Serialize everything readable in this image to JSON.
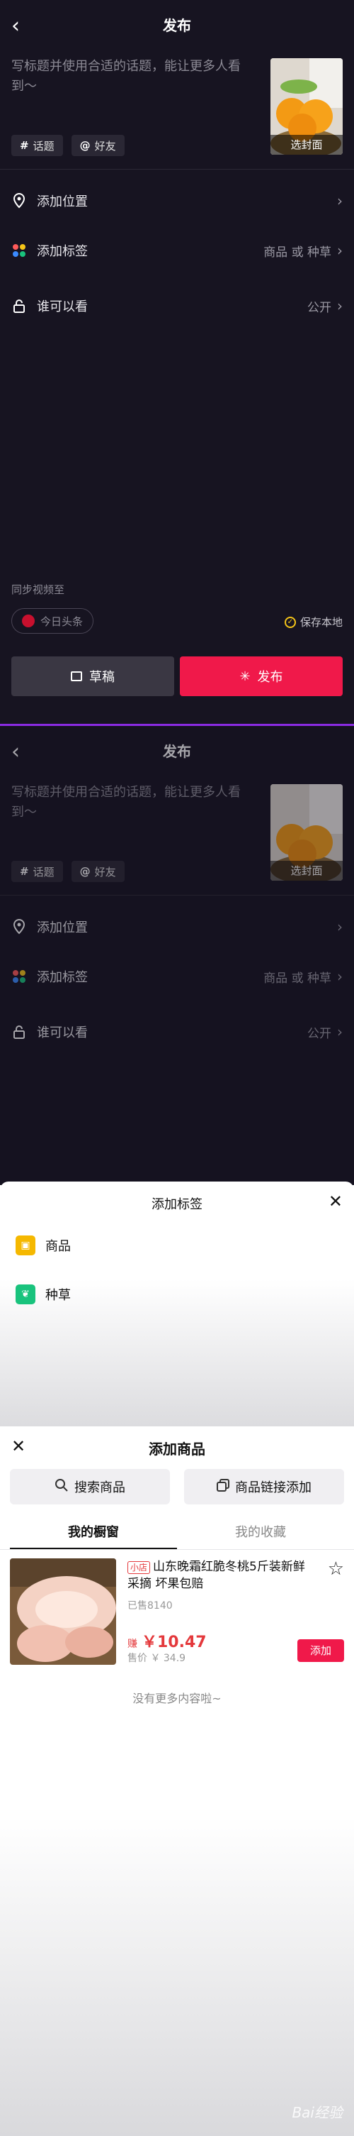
{
  "publish": {
    "title": "发布",
    "caption_placeholder": "写标题并使用合适的话题，能让更多人看到～",
    "cover_label": "选封面",
    "chips": [
      {
        "icon": "hash-icon",
        "label": "话题"
      },
      {
        "icon": "at-icon",
        "label": "好友"
      }
    ],
    "rows": {
      "location": {
        "label": "添加位置"
      },
      "tag": {
        "label": "添加标签",
        "value": "商品 或 种草"
      },
      "visibility": {
        "label": "谁可以看",
        "value": "公开"
      }
    },
    "sync_label": "同步视频至",
    "toutiao_label": "今日头条",
    "save_local_label": "保存本地",
    "draft_label": "草稿",
    "publish_label": "发布"
  },
  "tag_sheet": {
    "title": "添加标签",
    "items": [
      {
        "label": "商品",
        "color": "#f5b800"
      },
      {
        "label": "种草",
        "color": "#19c37d"
      }
    ]
  },
  "add_product": {
    "title": "添加商品",
    "search_label": "搜索商品",
    "link_label": "商品链接添加",
    "tabs": [
      "我的橱窗",
      "我的收藏"
    ],
    "product": {
      "badge": "小店",
      "name": "山东晚霜红脆冬桃5斤装新鲜采摘 坏果包赔",
      "sold": "已售8140",
      "earn_prefix": "赚",
      "earn_value": "￥10.47",
      "price": "售价 ￥ 34.9",
      "add_label": "添加"
    },
    "no_more": "没有更多内容啦~",
    "watermark": "Bai经验"
  },
  "colors": {
    "accent": "#f0194a",
    "dark_bg": "#171421"
  }
}
